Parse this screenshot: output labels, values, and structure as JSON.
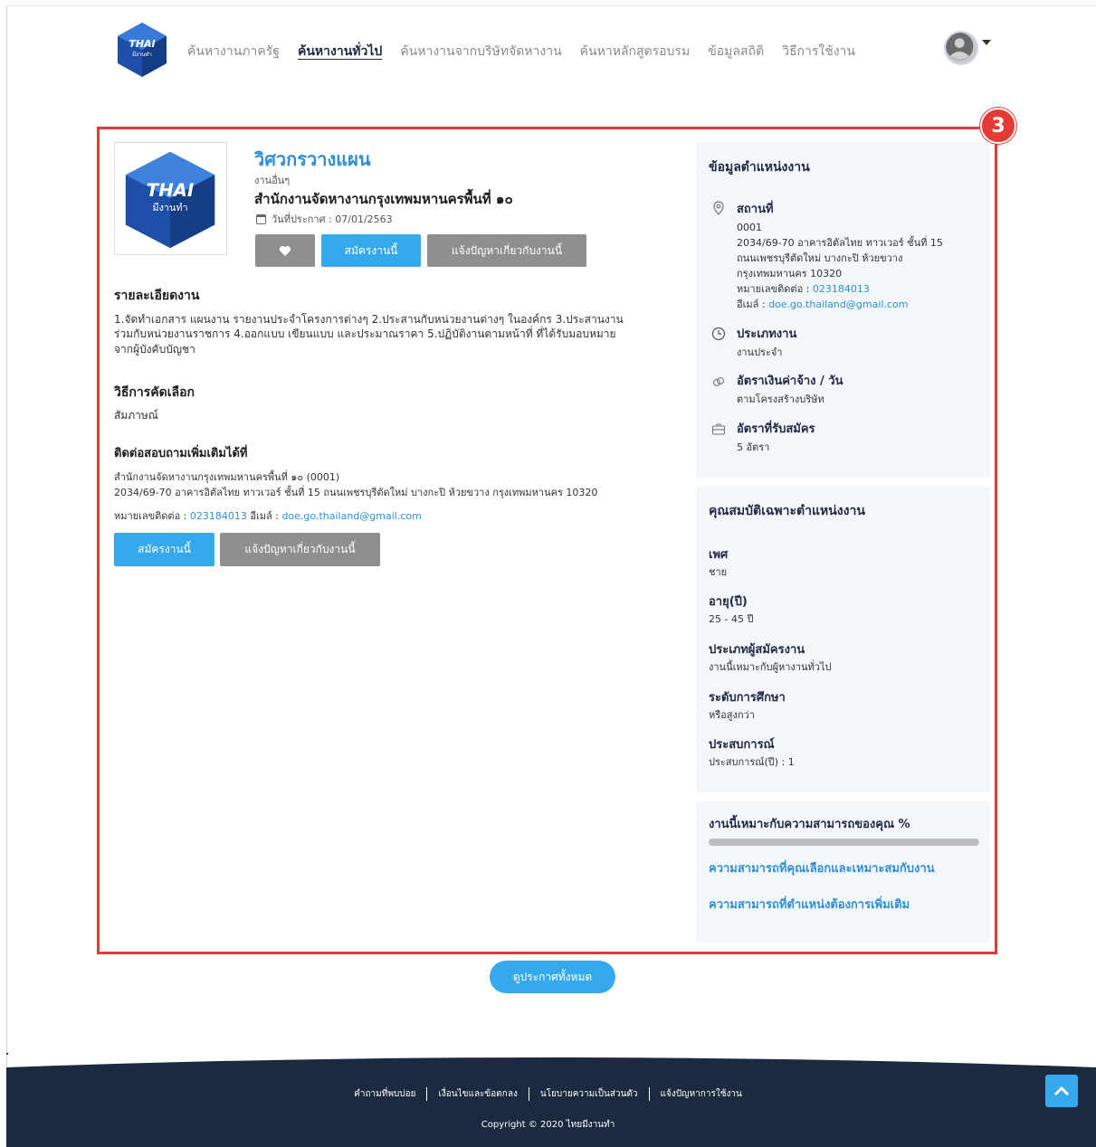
{
  "header": {
    "nav": [
      {
        "label": "ค้นหางานภาครัฐ",
        "active": false
      },
      {
        "label": "ค้นหางานทั่วไป",
        "active": true
      },
      {
        "label": "ค้นหางานจากบริษัทจัดหางาน",
        "active": false
      },
      {
        "label": "ค้นหาหลักสูตรอบรม",
        "active": false
      },
      {
        "label": "ข้อมูลสถิติ",
        "active": false
      },
      {
        "label": "วิธีการใช้งาน",
        "active": false
      }
    ],
    "logo_text_main": "THAI",
    "logo_text_sub": "มีงานทำ"
  },
  "annotation": {
    "number": "3",
    "color": "#e53935"
  },
  "job": {
    "title": "วิศวกรวางแผน",
    "category": "งานอื่นๆ",
    "org": "สำนักงานจัดหางานกรุงเทพมหานครพื้นที่ ๑๐",
    "date": "วันที่ประกาศ : 07/01/2563",
    "apply_label": "สมัครงานนี้",
    "report_label": "แจ้งปัญหาเกี่ยวกับงานนี้"
  },
  "detail": {
    "heading": "รายละเอียดงาน",
    "line1": "1.จัดทำเอกสาร แผนงาน รายงานประจำโครงการต่างๆ 2.ประสานกับหน่วยงานต่างๆ ในองค์กร 3.ประสานงาน",
    "line2": "ร่วมกับหน่วยงานราชการ 4.ออกแบบ เขียนแบบ และประมาณราคา 5.ปฏิบัติงานตามหน้าที่ ที่ได้รับมอบหมาย",
    "line3": "จากผู้บังคับบัญชา"
  },
  "selection": {
    "heading": "วิธีการคัดเลือก",
    "value": "สัมภาษณ์"
  },
  "contact": {
    "heading": "ติดต่อสอบถามเพิ่มเติมได้ที่",
    "line1": "สำนักงานจัดหางานกรุงเทพมหานครพื้นที่ ๑๐ (0001)",
    "line2": "2034/69-70 อาคารอิตัลไทย ทาวเวอร์ ชั้นที่ 15 ถนนเพชรบุรีตัดใหม่ บางกะปิ ห้วยขวาง กรุงเทพมหานคร 10320",
    "phone_label": "หมายเลขติดต่อ :",
    "phone": "023184013",
    "email_label": "อีเมล์ :",
    "email": "doe.go.thailand@gmail.com"
  },
  "info": {
    "heading": "ข้อมูลตำแหน่งงาน",
    "location_h": "สถานที่",
    "loc1": "0001",
    "loc2": "2034/69-70 อาคารอิตัลไทย ทาวเวอร์ ชั้นที่ 15",
    "loc3": "ถนนเพชรบุรีตัดใหม่ บางกะปิ ห้วยขวาง",
    "loc4": "กรุงเทพมหานคร 10320",
    "phone_label": "หมายเลขติดต่อ :",
    "phone": "023184013",
    "email_label": "อีเมล์ :",
    "email": "doe.go.thailand@gmail.com",
    "type_h": "ประเภทงาน",
    "type_v": "งานประจำ",
    "wage_h": "อัตราเงินค่าจ้าง / วัน",
    "wage_v": "ตามโครงสร้างบริษัท",
    "rate_h": "อัตราที่รับสมัคร",
    "rate_v": "5 อัตรา"
  },
  "qual": {
    "heading": "คุณสมบัติเฉพาะตำแหน่งงาน",
    "sex_h": "เพศ",
    "sex_v": "ชาย",
    "age_h": "อายุ(ปี)",
    "age_v": "25 - 45 ปี",
    "applicant_h": "ประเภทผู้สมัครงาน",
    "applicant_v": "งานนี้เหมาะกับผู้หางานทั่วไป",
    "edu_h": "ระดับการศึกษา",
    "edu_v": "หรือสูงกว่า",
    "exp_h": "ประสบการณ์",
    "exp_v": "ประสบการณ์(ปี) : 1"
  },
  "match": {
    "heading": "งานนี้เหมาะกับความสามารถของคุณ %",
    "percent": 0,
    "link1": "ความสามารถที่คุณเลือกและเหมาะสมกับงาน",
    "link2": "ความสามารถที่ตำแหน่งต้องการเพิ่มเติม"
  },
  "view_all": "ดูประกาศทั้งหมด",
  "footer": {
    "links": [
      "คำถามที่พบบ่อย",
      "เงื่อนไขและข้อตกลง",
      "นโยบายความเป็นส่วนตัว",
      "แจ้งปัญหาการใช้งาน"
    ],
    "copyright": "Copyright © 2020 ไทยมีงานทำ"
  },
  "colors": {
    "accent": "#35a9ec",
    "link": "#2e8fd6",
    "footer": "#1b2a3f",
    "annotation": "#e53935"
  }
}
